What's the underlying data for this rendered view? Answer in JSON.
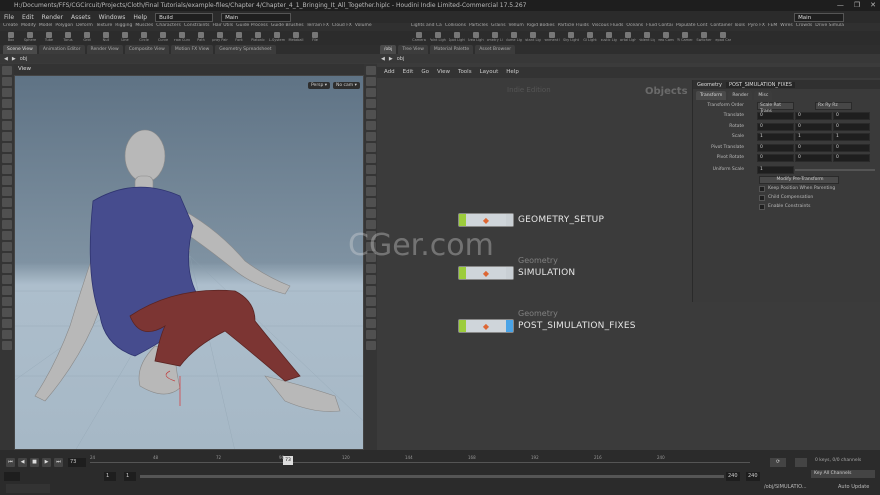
{
  "window": {
    "title": "H:/Documents/FFS/CGCircuit/Projects/Cloth/Final Tutorials/example-files/Chapter 4/Chapter_4_1_Bringing_It_All_Together.hiplc - Houdini Indie Limited-Commercial 17.5.267",
    "controls": [
      "—",
      "❐",
      "✕"
    ]
  },
  "menubar": {
    "items": [
      "File",
      "Edit",
      "Render",
      "Assets",
      "Windows",
      "Help"
    ],
    "desktop": "Build",
    "context": "Main",
    "right_desktop": "Main"
  },
  "shelf_tabs_left": [
    "Create",
    "Modify",
    "Model",
    "Polygon",
    "Deform",
    "Texture",
    "Rigging",
    "Muscles",
    "Characters",
    "Constraints",
    "Hair Utils",
    "Guide Process",
    "Guide Brushes",
    "Terrain FX",
    "Cloud FX",
    "Volume"
  ],
  "shelf_tabs_right": [
    "Lights and Ca",
    "Collisions",
    "Particles",
    "Grains",
    "Vellum",
    "Rigid Bodies",
    "Particle Fluids",
    "Viscous Fluids",
    "Oceans",
    "Fluid Contai",
    "Populate Cont",
    "Container Tools",
    "Pyro FX",
    "FEM",
    "Wires",
    "Crowds",
    "Drive Simula"
  ],
  "shelf_icons_left": [
    "Box",
    "Sphere",
    "Tube",
    "Torus",
    "Grid",
    "Null",
    "Line",
    "Circle",
    "Curve",
    "Draw Curve",
    "Path",
    "Spray Paint",
    "Font",
    "Platonic",
    "L-System",
    "Metaball",
    "File"
  ],
  "shelf_icons_right": [
    "Camera",
    "Point Light",
    "Spot Light",
    "Area Light",
    "Geometry Light",
    "Volume Light",
    "Distant Light",
    "Environment Light",
    "Sky Light",
    "GI Light",
    "Caustic Light",
    "Portal Light",
    "Ambient Light",
    "Stereo Camera",
    "VR Camera",
    "Switcher",
    "Gamepad Camera"
  ],
  "left_tabs": [
    "Scene View",
    "Animation Editor",
    "Render View",
    "Composite View",
    "Motion FX View",
    "Geometry Spreadsheet"
  ],
  "left_path": "obj",
  "viewport": {
    "label": "View",
    "persp": "Persp ▾",
    "cam": "No cam ▾"
  },
  "right_tabs": [
    "/obj",
    "Tree View",
    "Material Palette",
    "Asset Browser"
  ],
  "right_path": "obj",
  "net_menu": [
    "Add",
    "Edit",
    "Go",
    "View",
    "Tools",
    "Layout",
    "Help"
  ],
  "net_watermark": "Indie Edition",
  "net_context": "Objects",
  "overlay_watermark": "CGer.com",
  "nodes": [
    {
      "name": "GEOMETRY_SETUP",
      "sub": ""
    },
    {
      "name": "SIMULATION",
      "sub": "Geometry"
    },
    {
      "name": "POST_SIMULATION_FIXES",
      "sub": "Geometry"
    }
  ],
  "parm": {
    "node_type": "Geometry",
    "node_name": "POST_SIMULATION_FIXES",
    "tabs": [
      "Transform",
      "Render",
      "Misc"
    ],
    "transform_order_label": "Transform Order",
    "transform_order_value": "Scale Rot Trans",
    "rot_order_value": "Rx Ry Rz",
    "rows": [
      {
        "label": "Translate",
        "values": [
          "0",
          "0",
          "0"
        ]
      },
      {
        "label": "Rotate",
        "values": [
          "0",
          "0",
          "0"
        ]
      },
      {
        "label": "Scale",
        "values": [
          "1",
          "1",
          "1"
        ]
      },
      {
        "label": "Pivot Translate",
        "values": [
          "0",
          "0",
          "0"
        ]
      },
      {
        "label": "Pivot Rotate",
        "values": [
          "0",
          "0",
          "0"
        ]
      }
    ],
    "uniform_label": "Uniform Scale",
    "uniform_value": "1",
    "modify_button": "Modify Pre-Transform",
    "checkboxes": [
      "Keep Position When Parenting",
      "Child Compensation",
      "Enable Constraints"
    ]
  },
  "timeline": {
    "frame": "73",
    "ticks": [
      "24",
      "48",
      "72",
      "96",
      "120",
      "144",
      "168",
      "192",
      "216",
      "240"
    ],
    "start": "1",
    "start2": "1",
    "end": "240",
    "end2": "240",
    "keys": "0 keys, 0/0 channels",
    "key_all": "Key All Channels",
    "status": "/obj/SIMULATIO...",
    "auto_update": "Auto Update"
  }
}
